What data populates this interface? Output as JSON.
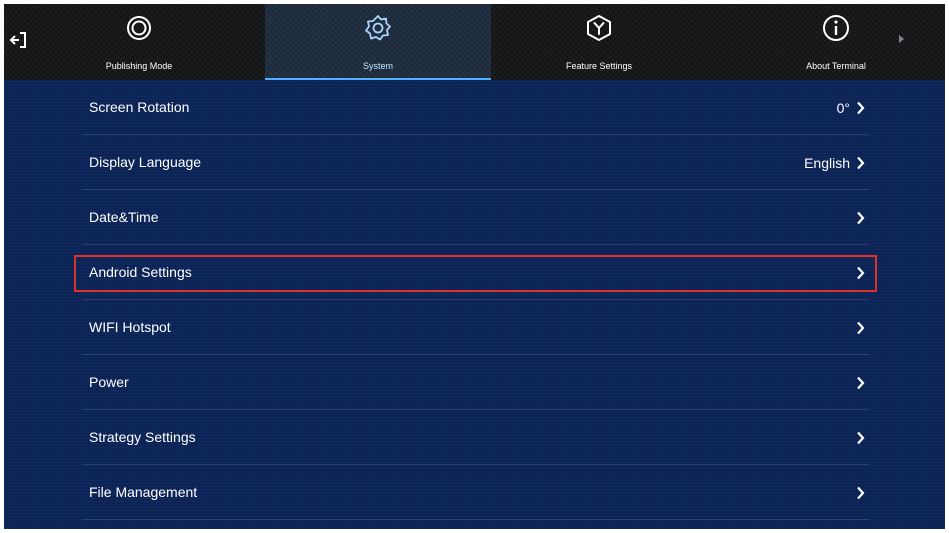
{
  "header": {
    "exit_icon": "exit-icon",
    "tabs": [
      {
        "label": "Publishing Mode",
        "icon": "publishing-mode-icon",
        "active": false
      },
      {
        "label": "System",
        "icon": "gear-icon",
        "active": true
      },
      {
        "label": "Feature Settings",
        "icon": "feature-settings-icon",
        "active": false
      },
      {
        "label": "About Terminal",
        "icon": "info-icon",
        "active": false
      }
    ],
    "more_icon": "chevron-right-small-icon",
    "active_color": "#4fb0ff"
  },
  "settings": {
    "items": [
      {
        "label": "Screen Rotation",
        "value": "0°"
      },
      {
        "label": "Display Language",
        "value": "English"
      },
      {
        "label": "Date&Time",
        "value": ""
      },
      {
        "label": "Android Settings",
        "value": "",
        "highlighted": true
      },
      {
        "label": "WIFI Hotspot",
        "value": ""
      },
      {
        "label": "Power",
        "value": ""
      },
      {
        "label": "Strategy Settings",
        "value": ""
      },
      {
        "label": "File Management",
        "value": ""
      }
    ],
    "chevron_icon": "chevron-right-icon",
    "highlight_color": "#e0322b"
  },
  "colors": {
    "background": "#0c2558",
    "topbar": "#141517",
    "text": "#ffffff"
  }
}
